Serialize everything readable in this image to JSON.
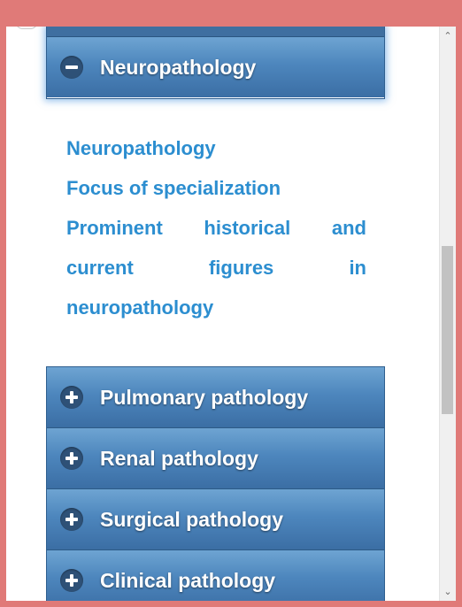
{
  "accordion": {
    "active": {
      "label": "Neuropathology",
      "icon": "minus-circle-icon",
      "links": [
        "Neuropathology",
        "Focus of specialization",
        "Prominent historical and current figures in neuropathology"
      ]
    },
    "items": [
      {
        "label": "Pulmonary pathology",
        "icon": "plus-circle-icon"
      },
      {
        "label": "Renal pathology",
        "icon": "plus-circle-icon"
      },
      {
        "label": "Surgical pathology",
        "icon": "plus-circle-icon"
      },
      {
        "label": "Clinical pathology",
        "icon": "plus-circle-icon"
      }
    ]
  },
  "colors": {
    "header_gradient_top": "#6ea4d2",
    "header_gradient_bottom": "#3b6ea4",
    "link_color": "#2c8ed0",
    "frame_color": "#e07a78"
  },
  "scrollbar": {
    "up_icon": "chevron-up-icon",
    "down_icon": "chevron-down-icon"
  }
}
